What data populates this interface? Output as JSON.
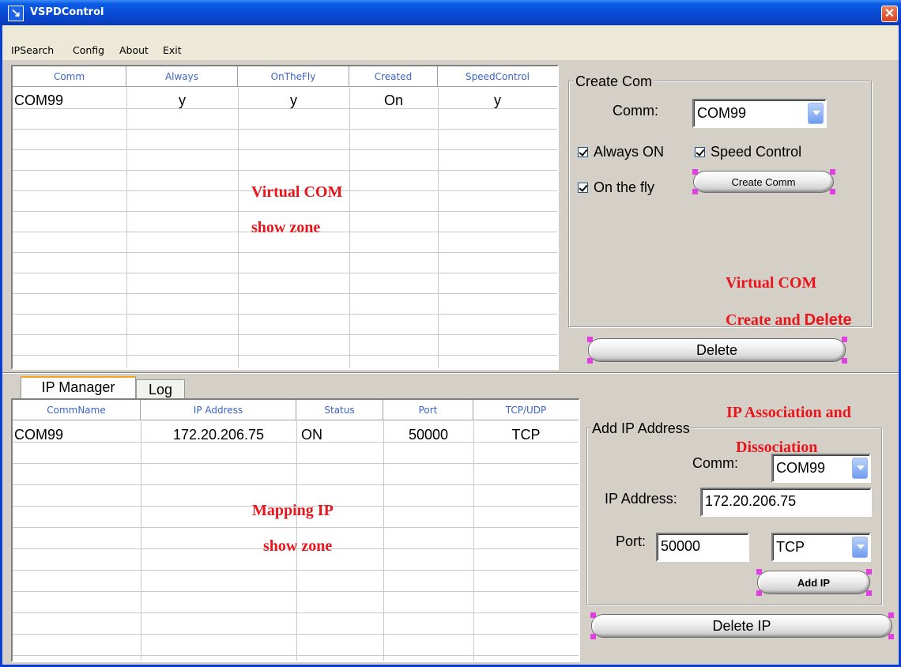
{
  "window": {
    "title": "VSPDControl",
    "close_glyph": "✕",
    "icon_glyph": "↘"
  },
  "menu": [
    "IPSearch",
    "Config",
    "About",
    "Exit"
  ],
  "com_grid": {
    "headers": [
      "Comm",
      "Always",
      "OnTheFly",
      "Created",
      "SpeedControl"
    ],
    "rows": [
      [
        "COM99",
        "y",
        "y",
        "On",
        "y"
      ]
    ]
  },
  "com_annotation": [
    "Virtual COM",
    "show zone"
  ],
  "create_com": {
    "group_title": "Create Com",
    "comm_label": "Comm:",
    "comm_value": "COM99",
    "always_on_label": "Always ON",
    "always_on_checked": true,
    "speed_control_label": "Speed Control",
    "speed_control_checked": true,
    "on_the_fly_label": "On the fly",
    "on_the_fly_checked": true,
    "create_button": "Create Comm",
    "annotation_line1": "Virtual COM",
    "annotation_line2_a": "Create and",
    "annotation_line2_b": "Delete",
    "delete_button": "Delete"
  },
  "tabs": [
    "IP Manager",
    "Log"
  ],
  "ip_grid": {
    "headers": [
      "CommName",
      "IP Address",
      "Status",
      "Port",
      "TCP/UDP"
    ],
    "rows": [
      [
        "COM99",
        "172.20.206.75",
        "ON",
        "50000",
        "TCP"
      ]
    ]
  },
  "ip_annotation": [
    "Mapping IP",
    "show zone"
  ],
  "add_ip": {
    "annotation_line1": "IP Association and",
    "annotation_line2": "Dissociation",
    "group_title": "Add IP Address",
    "comm_label": "Comm:",
    "comm_value": "COM99",
    "ip_label": "IP Address:",
    "ip_value": "172.20.206.75",
    "port_label": "Port:",
    "port_value": "50000",
    "protocol_value": "TCP",
    "add_button": "Add IP",
    "delete_button": "Delete IP"
  },
  "colors": {
    "annotation": "#e8161c",
    "header_text": "#3a63c8",
    "titlebar": "#0848d0"
  }
}
